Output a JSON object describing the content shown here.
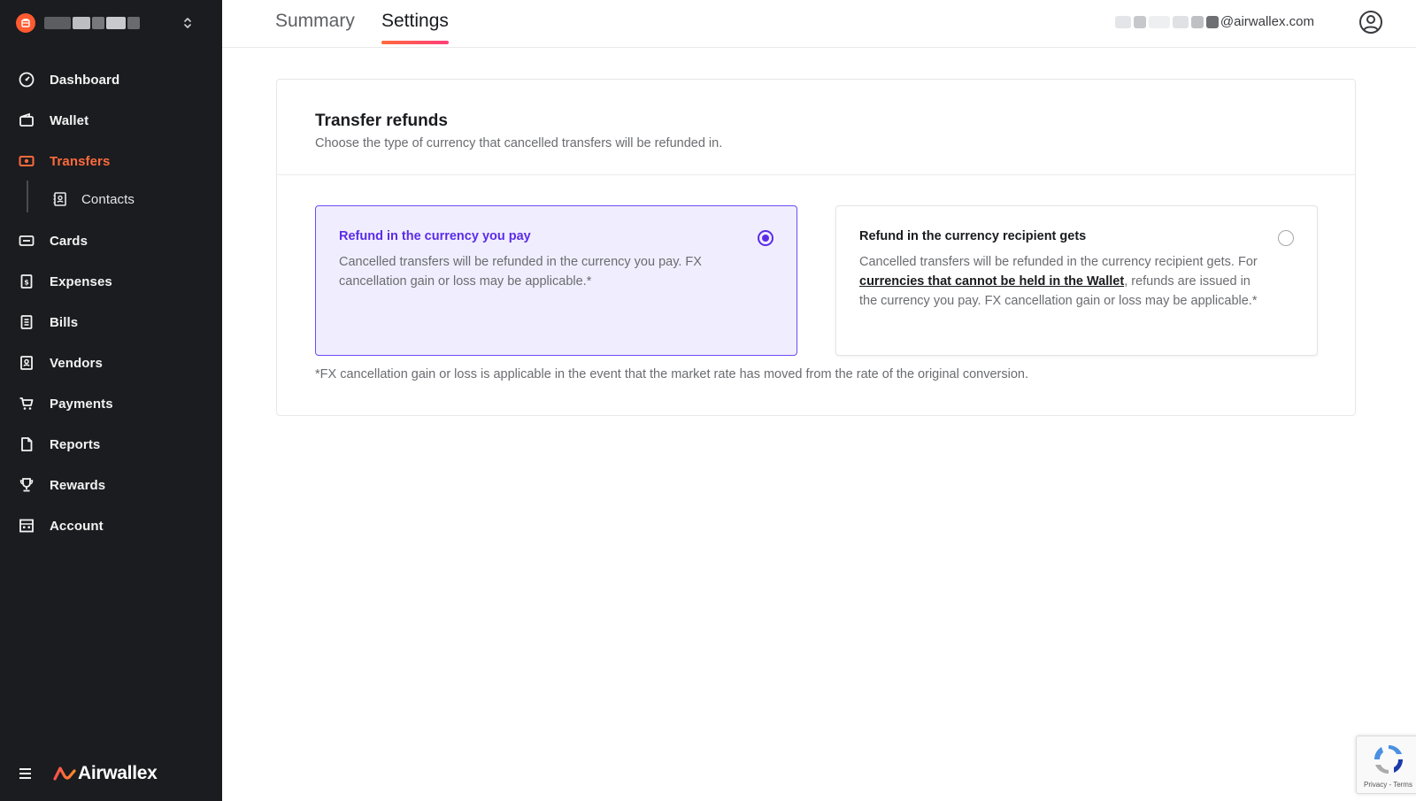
{
  "sidebar": {
    "items": [
      {
        "label": "Dashboard",
        "icon": "dashboard-icon"
      },
      {
        "label": "Wallet",
        "icon": "wallet-icon"
      },
      {
        "label": "Transfers",
        "icon": "transfers-icon",
        "active": true
      },
      {
        "label": "Contacts",
        "icon": "contacts-icon",
        "sub": true
      },
      {
        "label": "Cards",
        "icon": "card-icon"
      },
      {
        "label": "Expenses",
        "icon": "expenses-icon"
      },
      {
        "label": "Bills",
        "icon": "bills-icon"
      },
      {
        "label": "Vendors",
        "icon": "vendors-icon"
      },
      {
        "label": "Payments",
        "icon": "cart-icon"
      },
      {
        "label": "Reports",
        "icon": "report-icon"
      },
      {
        "label": "Rewards",
        "icon": "trophy-icon"
      },
      {
        "label": "Account",
        "icon": "building-icon"
      }
    ],
    "brand": "Airwallex"
  },
  "header": {
    "tabs": [
      {
        "label": "Summary"
      },
      {
        "label": "Settings",
        "active": true
      }
    ],
    "user_email_suffix": "@airwallex.com"
  },
  "card": {
    "title": "Transfer refunds",
    "subtitle": "Choose the type of currency that cancelled transfers will be refunded in.",
    "options": [
      {
        "title": "Refund in the currency you pay",
        "description": "Cancelled transfers will be refunded in the currency you pay. FX cancellation gain or loss may be applicable.*",
        "selected": true
      },
      {
        "title": "Refund in the currency recipient gets",
        "description_pre": "Cancelled transfers will be refunded in the currency recipient gets. For ",
        "description_link": "currencies that cannot be held in the Wallet",
        "description_post": ", refunds are issued in the currency you pay. FX cancellation gain or loss may be applicable.*",
        "selected": false
      }
    ],
    "footnote": "*FX cancellation gain or loss is applicable in the event that the market rate has moved from the rate of the original conversion."
  },
  "recaptcha": {
    "text": "Privacy - Terms"
  },
  "colors": {
    "sidebar_bg": "#1b1c1f",
    "accent": "#ff6a3d",
    "selected_purple": "#5b2ce8",
    "selected_bg": "#f0eefe"
  }
}
